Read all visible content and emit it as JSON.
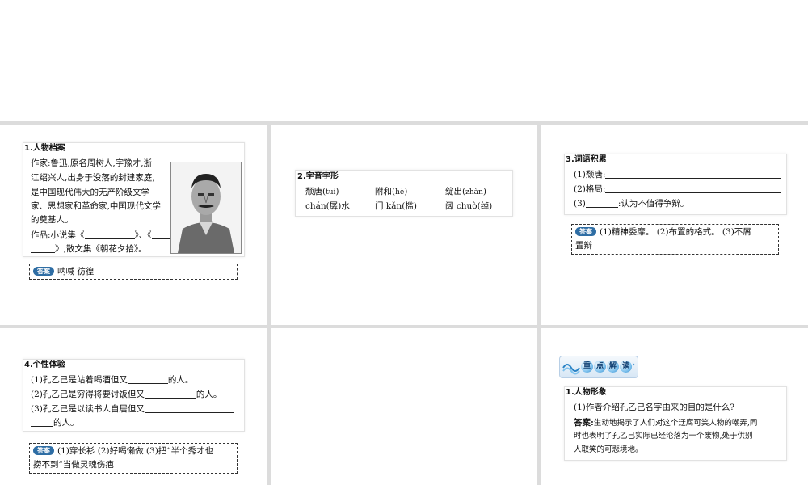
{
  "s1": {
    "heading": "1.人物档案",
    "author_lines": [
      "作家:鲁迅,原名周树人,字豫才,浙",
      "江绍兴人,出身于没落的封建家庭,",
      "是中国现代伟大的无产阶级文学",
      "家、思想家和革命家,中国现代文学",
      "的奠基人。"
    ],
    "works_a": "作品:小说集《",
    "works_b": "》、《",
    "works_c": "》,散文集《朝花夕拾》。",
    "answer_label": "答案",
    "answer": "呐喊  彷徨"
  },
  "s2": {
    "heading": "2.字音字形",
    "r1": [
      "颓唐(",
      "tuí",
      ")",
      "附和(",
      "hè",
      ")",
      "绽出(",
      "zhàn",
      ")"
    ],
    "r2": [
      "chán(",
      "孱",
      ")水",
      "门 kǎn(",
      "槛",
      ")",
      "阔 chuò(",
      "绰",
      ")"
    ]
  },
  "s3": {
    "heading": "3.词语积累",
    "q1": "(1)颓唐:",
    "q2": "(2)格局:",
    "q3a": "(3)",
    "q3b": ":认为不值得争辩。",
    "answer_label": "答案",
    "answer_l1": "(1)精神委靡。  (2)布置的格式。  (3)不屑",
    "answer_l2": "置辩"
  },
  "s4": {
    "heading": "4.个性体验",
    "q1a": "(1)孔乙己是站着喝酒但又",
    "q1b": "的人。",
    "q2a": "(2)孔乙己是穷得将要讨饭但又",
    "q2b": "的人。",
    "q3a": "(3)孔乙己是以读书人自居但又",
    "q3b": "的人。",
    "answer_label": "答案",
    "answer_l1": "(1)穿长衫  (2)好喝懒做  (3)把“半个秀才也",
    "answer_l2": "捞不到”当做灵魂伤疤"
  },
  "s6": {
    "banner": [
      "重",
      "点",
      "解",
      "读"
    ],
    "heading": "1.人物形象",
    "question": "(1)作者介绍孔乙己名字由来的目的是什么?",
    "answer_label": "答案:",
    "answer_l1": "生动地揭示了人们对这个迂腐可笑人物的嘲弄,同",
    "answer_l2": "时也表明了孔乙己实际已经沦落为一个废物,处于供别",
    "answer_l3": "人取笑的可悲境地。"
  },
  "colors": {
    "accent": "#2e6da4",
    "divider": "#dcdcdc"
  }
}
